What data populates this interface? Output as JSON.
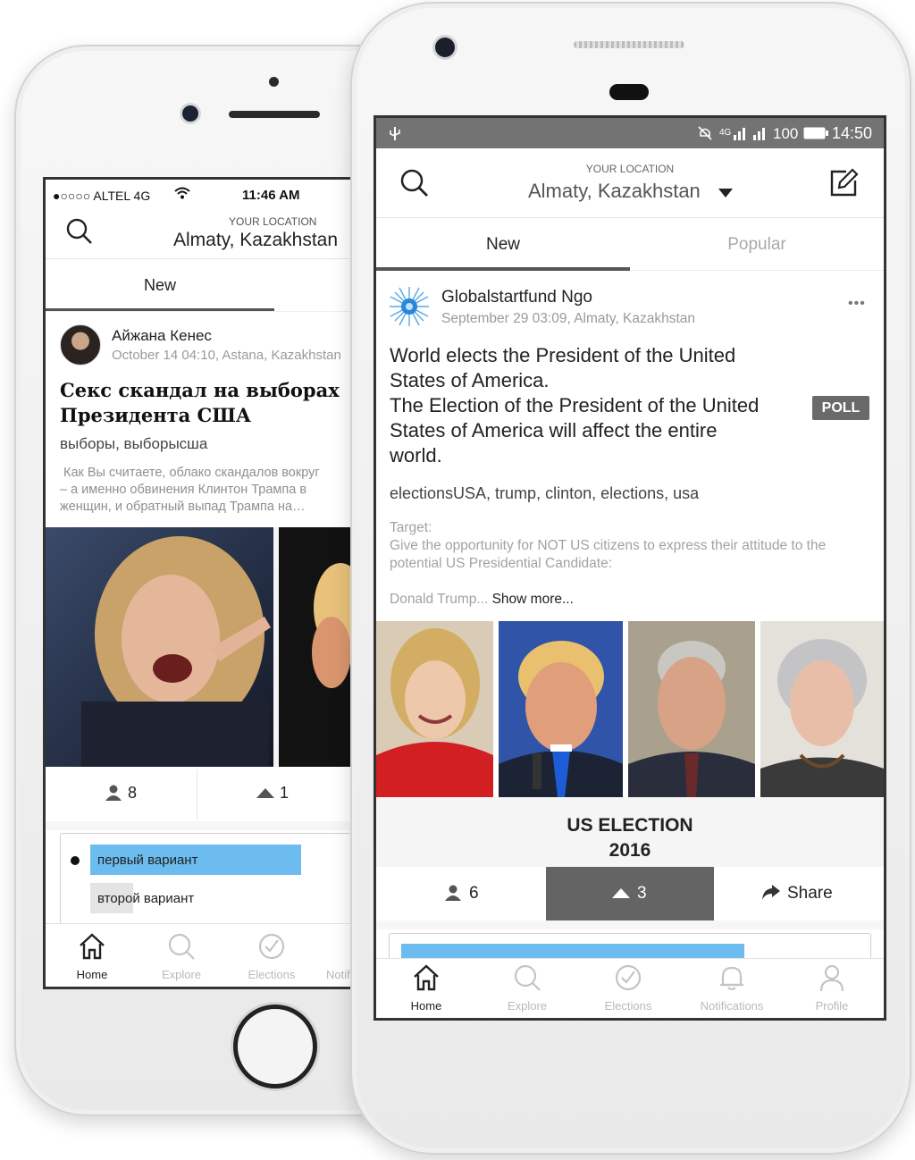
{
  "back_phone": {
    "status_bar": {
      "carrier": "●○○○○ ALTEL 4G",
      "time": "11:46 AM"
    },
    "header": {
      "location_caption": "YOUR LOCATION",
      "location": "Almaty, Kazakhstan"
    },
    "tabs": [
      "New"
    ],
    "post": {
      "author": "Айжана Кенес",
      "meta": "October 14 04:10, Astana, Kazakhstan",
      "title": "Секс скандал на выборах Президента США",
      "tags": "выборы, выборысша",
      "excerpt_lines": [
        "Как Вы считаете, облако скандалов вокруг",
        "– а именно  обвинения Клинтон Трампа в",
        "женщин, и обратный выпад Трампа на…"
      ],
      "participants": "8",
      "votes": "1",
      "options": [
        "первый вариант",
        "второй вариант"
      ]
    },
    "bottom_nav": [
      "Home",
      "Explore",
      "Elections",
      "Notifications"
    ]
  },
  "front_phone": {
    "status_bar": {
      "network": "4G",
      "battery": "100",
      "time": "14:50"
    },
    "header": {
      "location_caption": "YOUR LOCATION",
      "location": "Almaty, Kazakhstan"
    },
    "tabs": [
      "New",
      "Popular"
    ],
    "post": {
      "author": "Globalstartfund Ngo",
      "meta": "September 29 03:09, Almaty, Kazakhstan",
      "more": "•••",
      "title_lines": [
        "World elects the President of the United",
        "States of America.",
        "The Election of the President of the United",
        "States of America will affect the entire",
        "world."
      ],
      "badge": "POLL",
      "tags": "electionsUSA, trump, clinton, elections, usa",
      "target_label": "Target:",
      "target_lines": [
        "Give the opportunity for NOT US citizens to express their attitude to the",
        "potential US Presidential Candidate:"
      ],
      "preview": "Donald Trump...",
      "show_more": "Show more...",
      "image_caption_lines": [
        "US ELECTION",
        "2016"
      ],
      "participants": "6",
      "votes": "3",
      "share": "Share"
    },
    "bottom_nav": [
      "Home",
      "Explore",
      "Elections",
      "Notifications",
      "Profile"
    ]
  },
  "colors": {
    "accent_blue": "#6cbcef",
    "dark_gray": "#646464",
    "badge_gray": "#6a6a6a"
  },
  "icons": [
    "search-icon",
    "edit-icon",
    "caret-down-icon",
    "person-icon",
    "arrow-up-icon",
    "share-arrow-icon",
    "home-icon",
    "explore-icon",
    "elections-check-icon",
    "bell-icon",
    "profile-icon",
    "wifi-icon",
    "usb-icon",
    "mute-icon",
    "signal-icon",
    "battery-icon",
    "more-dots-icon",
    "org-logo-icon"
  ]
}
